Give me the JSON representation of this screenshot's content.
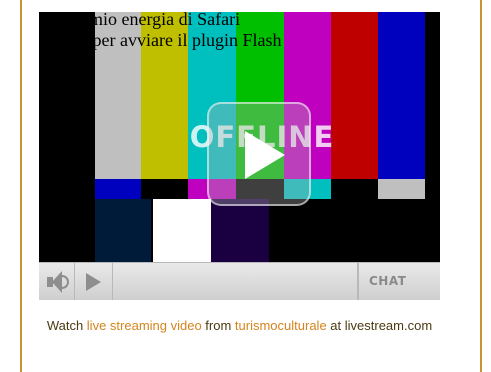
{
  "player": {
    "flash_notice_line1": "rmio energia di Safari",
    "flash_notice_line2": "ic per avviare il plugin Flash",
    "offline_label": "OFFLINE",
    "controls": {
      "mute_icon": "speaker-icon",
      "play_icon": "play-icon",
      "chat_label": "CHAT"
    },
    "test_pattern_colors": [
      "#c0c0c0",
      "#c0c000",
      "#00c0c0",
      "#00c000",
      "#c000c0",
      "#c00000",
      "#0000c0"
    ]
  },
  "caption": {
    "prefix": "Watch ",
    "link1": "live streaming video",
    "middle": " from ",
    "link2": "turismoculturale",
    "suffix": " at livestream.com"
  },
  "colors": {
    "border": "#c8942f",
    "link": "#d5841e"
  }
}
